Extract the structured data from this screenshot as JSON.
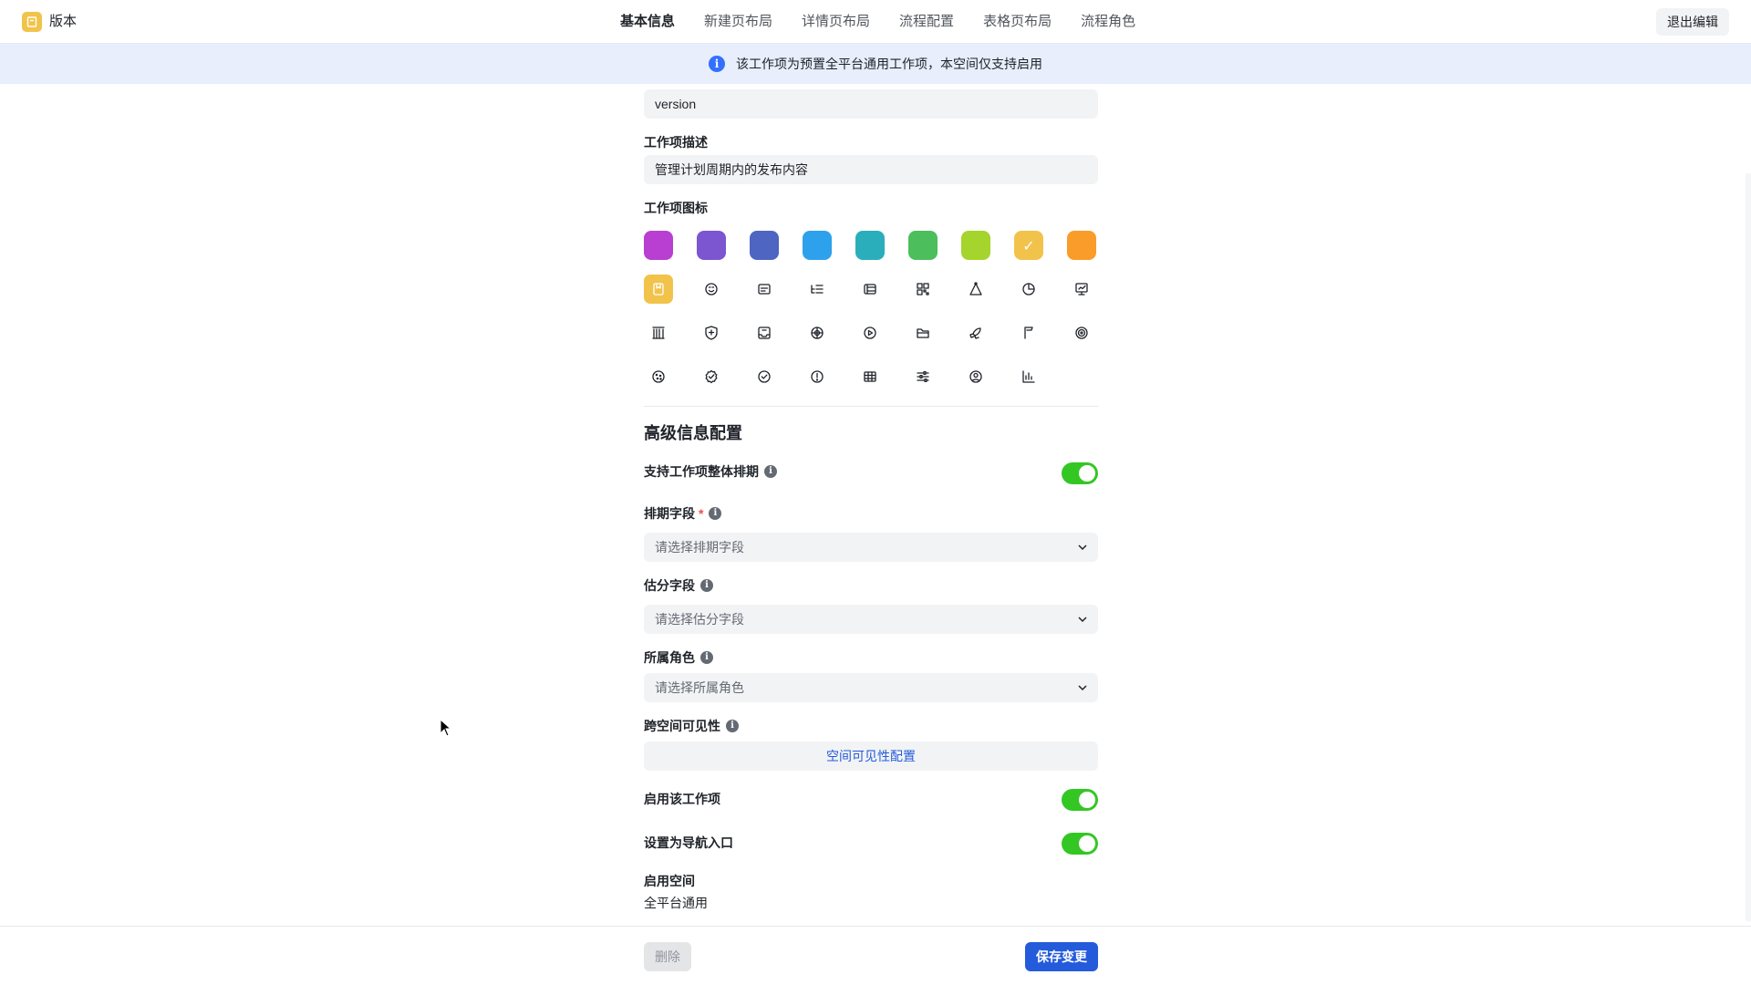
{
  "header": {
    "app_title": "版本",
    "tabs": [
      {
        "label": "基本信息",
        "active": true
      },
      {
        "label": "新建页布局",
        "active": false
      },
      {
        "label": "详情页布局",
        "active": false
      },
      {
        "label": "流程配置",
        "active": false
      },
      {
        "label": "表格页布局",
        "active": false
      },
      {
        "label": "流程角色",
        "active": false
      }
    ],
    "exit_label": "退出编辑"
  },
  "notice": {
    "text": "该工作项为预置全平台通用工作项，本空间仅支持启用"
  },
  "form": {
    "api_name_value": "version",
    "description_label": "工作项描述",
    "description_value": "管理计划周期内的发布内容",
    "icon_label": "工作项图标",
    "colors": [
      "#b83fd1",
      "#7c55d1",
      "#4f65c2",
      "#2ea1ec",
      "#2aaebc",
      "#4cbe5c",
      "#a5d42c",
      "#f2c34a",
      "#fa9c2a"
    ],
    "selected_color_index": 7,
    "icons": [
      "bookmark-icon",
      "smile-icon",
      "card-icon",
      "list-indent-icon",
      "stack-icon",
      "qrcode-icon",
      "vector-icon",
      "pie-clock-icon",
      "presentation-icon",
      "library-icon",
      "shield-plus-icon",
      "inbox-icon",
      "crosshair-icon",
      "play-circle-icon",
      "folder-icon",
      "rocket-icon",
      "flag-icon",
      "target-icon",
      "cookie-icon",
      "badge-check-icon",
      "check-circle-icon",
      "alert-circle-icon",
      "table-icon",
      "sliders-icon",
      "user-circle-icon",
      "bar-chart-icon"
    ],
    "selected_icon_index": 0
  },
  "advanced": {
    "title": "高级信息配置",
    "schedule_label": "支持工作项整体排期",
    "schedule_enabled": true,
    "schedule_field_label": "排期字段",
    "schedule_field_required_mark": "*",
    "schedule_field_placeholder": "请选择排期字段",
    "estimate_field_label": "估分字段",
    "estimate_field_placeholder": "请选择估分字段",
    "role_label": "所属角色",
    "role_placeholder": "请选择所属角色",
    "visibility_label": "跨空间可见性",
    "visibility_button": "空间可见性配置",
    "enable_label": "启用该工作项",
    "enable_on": true,
    "nav_label": "设置为导航入口",
    "nav_on": true,
    "space_label": "启用空间",
    "space_value": "全平台通用"
  },
  "footer": {
    "delete_label": "删除",
    "save_label": "保存变更"
  },
  "info_glyph": "i",
  "check_glyph": "✓"
}
